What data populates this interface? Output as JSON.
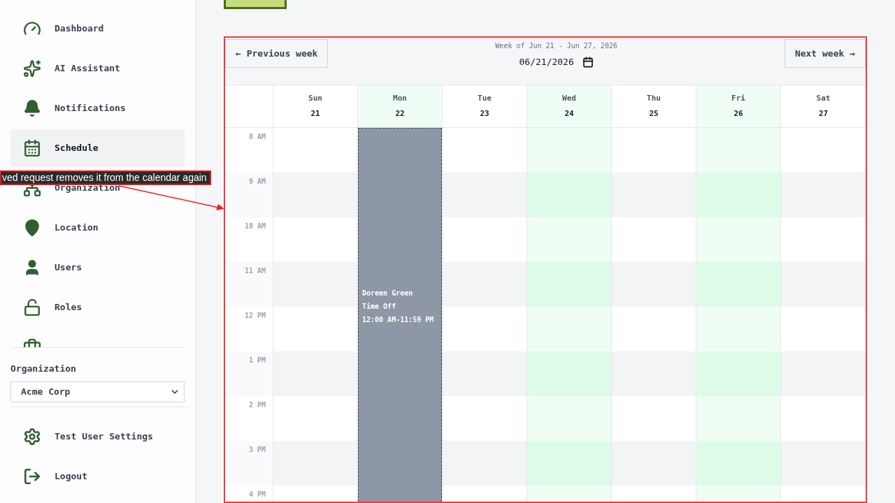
{
  "nav": {
    "items": [
      {
        "label": "Dashboard",
        "selected": false
      },
      {
        "label": "AI Assistant",
        "selected": false
      },
      {
        "label": "Notifications",
        "selected": false
      },
      {
        "label": "Schedule",
        "selected": true
      },
      {
        "label": "Organization",
        "selected": false
      },
      {
        "label": "Location",
        "selected": false
      },
      {
        "label": "Users",
        "selected": false
      },
      {
        "label": "Roles",
        "selected": false
      }
    ]
  },
  "organization": {
    "label": "Organization",
    "value": "Acme Corp"
  },
  "footer_items": [
    {
      "label": "Test User Settings"
    },
    {
      "label": "Logout"
    }
  ],
  "annotation": {
    "text": "ved request removes it from the calendar again"
  },
  "calendar": {
    "previous": "← Previous week",
    "next": "Next week →",
    "week_label": "Week of Jun 21 - Jun 27, 2026",
    "date": "06/21/2026",
    "days": [
      {
        "name": "Sun",
        "date": "21",
        "highlighted": false
      },
      {
        "name": "Mon",
        "date": "22",
        "highlighted": true,
        "events": [
          {
            "name": "Doreen Green",
            "type": "Time Off",
            "time": "12:00 AM-11:59 PM"
          }
        ]
      },
      {
        "name": "Tue",
        "date": "23",
        "highlighted": false
      },
      {
        "name": "Wed",
        "date": "24",
        "highlighted": true
      },
      {
        "name": "Thu",
        "date": "25",
        "highlighted": false
      },
      {
        "name": "Fri",
        "date": "26",
        "highlighted": true
      },
      {
        "name": "Sat",
        "date": "27",
        "highlighted": false
      }
    ],
    "hours": [
      "8 AM",
      "9 AM",
      "10 AM",
      "11 AM",
      "12 PM",
      "1 PM",
      "2 PM",
      "3 PM",
      "4 PM"
    ]
  }
}
